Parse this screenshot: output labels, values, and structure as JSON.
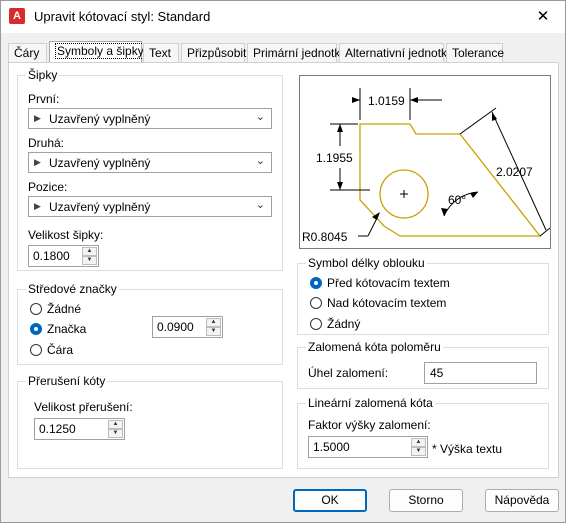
{
  "window": {
    "title": "Upravit kótovací styl: Standard",
    "app_icon": "A",
    "close_glyph": "✕"
  },
  "tabs": [
    {
      "label": "Čáry"
    },
    {
      "label": "Symboly a šipky",
      "active": true
    },
    {
      "label": "Text"
    },
    {
      "label": "Přizpůsobit"
    },
    {
      "label": "Primární jednotky"
    },
    {
      "label": "Alternativní jednotky"
    },
    {
      "label": "Tolerance"
    }
  ],
  "arrows": {
    "title": "Šipky",
    "first_label": "První:",
    "first_value": "Uzavřený vyplněný",
    "second_label": "Druhá:",
    "second_value": "Uzavřený vyplněný",
    "leader_label": "Pozice:",
    "leader_value": "Uzavřený vyplněný",
    "size_label": "Velikost šipky:",
    "size_value": "0.1800"
  },
  "center_marks": {
    "title": "Středové značky",
    "options": [
      "Žádné",
      "Značka",
      "Čára"
    ],
    "selected": "Značka",
    "size_value": "0.0900"
  },
  "dim_break": {
    "title": "Přerušení kóty",
    "size_label": "Velikost přerušení:",
    "size_value": "0.1250"
  },
  "preview": {
    "dim_top": "1.0159",
    "dim_left": "1.1955",
    "dim_right": "2.0207",
    "angle": "60°",
    "radius": "R0.8045"
  },
  "arc_symbol": {
    "title": "Symbol délky oblouku",
    "options": [
      "Před kótovacím textem",
      "Nad kótovacím textem",
      "Žádný"
    ],
    "selected": "Před kótovacím textem"
  },
  "radius_jog": {
    "title": "Zalomená kóta poloměru",
    "angle_label": "Úhel zalomení:",
    "angle_value": "45"
  },
  "linear_jog": {
    "title": "Lineární zalomená kóta",
    "height_label": "Faktor výšky zalomení:",
    "height_value": "1.5000",
    "suffix": "* Výška textu"
  },
  "buttons": {
    "ok": "OK",
    "cancel": "Storno",
    "help": "Nápověda"
  }
}
